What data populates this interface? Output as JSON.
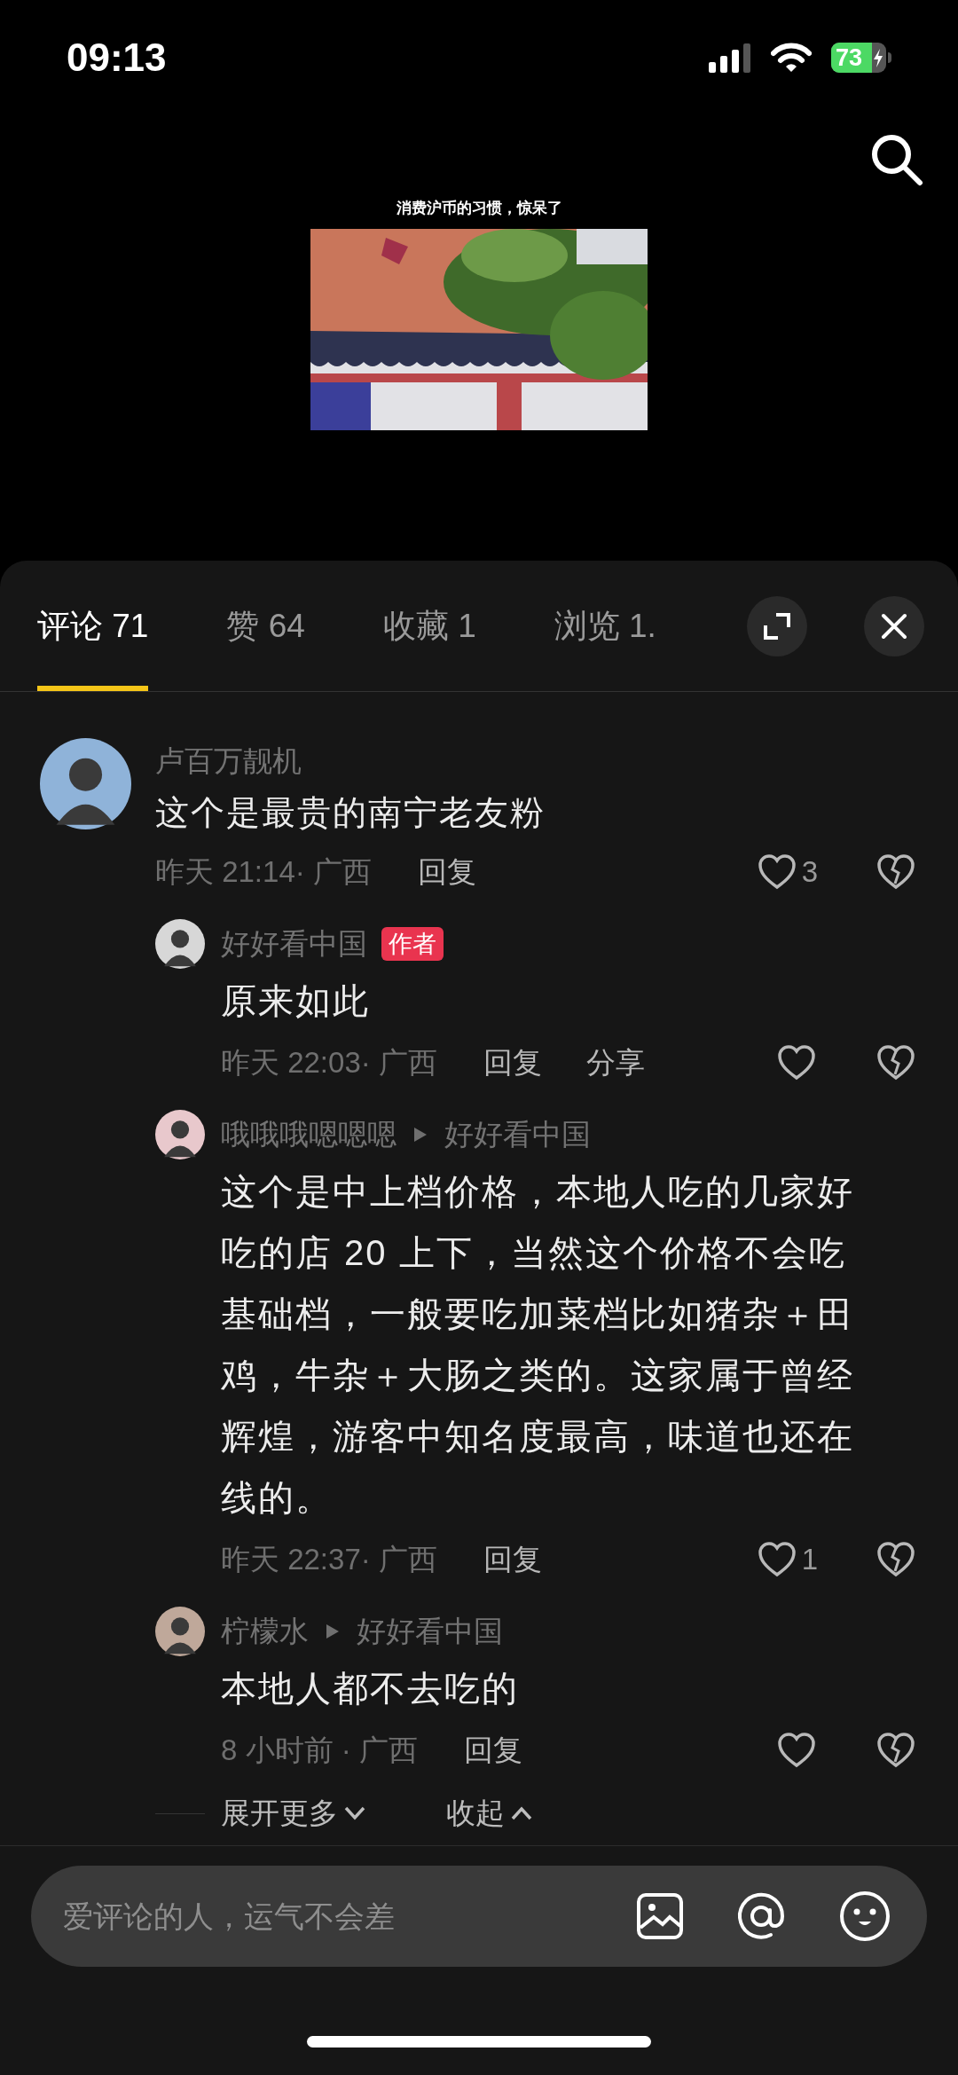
{
  "status_bar": {
    "time": "09:13",
    "battery": "73"
  },
  "video": {
    "caption": "消费沪币的习惯，惊呆了"
  },
  "tabs": [
    {
      "label": "评论 71",
      "selected": true
    },
    {
      "label": "赞 64",
      "selected": false
    },
    {
      "label": "收藏 1",
      "selected": false
    },
    {
      "label": "浏览 1.",
      "selected": false
    }
  ],
  "comments": [
    {
      "user": "卢百万靓机",
      "text": "这个是最贵的南宁老友粉",
      "meta": "昨天 21:14· 广西",
      "actions": [
        "回复"
      ],
      "likes": "3",
      "replies": [
        {
          "user": "好好看中国",
          "badge": "作者",
          "text": "原来如此",
          "meta": "昨天 22:03· 广西",
          "actions": [
            "回复",
            "分享"
          ]
        },
        {
          "user": "哦哦哦嗯嗯嗯",
          "reply_to": "好好看中国",
          "text": "这个是中上档价格，本地人吃的几家好吃的店 20 上下，当然这个价格不会吃基础档，一般要吃加菜档比如猪杂＋田鸡，牛杂＋大肠之类的。这家属于曾经辉煌，游客中知名度最高，味道也还在线的。",
          "meta": "昨天 22:37· 广西",
          "actions": [
            "回复"
          ],
          "likes": "1"
        },
        {
          "user": "柠檬水",
          "reply_to": "好好看中国",
          "text": "本地人都不去吃的",
          "meta": "8 小时前 · 广西",
          "actions": [
            "回复"
          ]
        }
      ]
    }
  ],
  "thread_controls": {
    "expand": "展开更多",
    "collapse": "收起"
  },
  "input": {
    "placeholder": "爱评论的人，运气不会差"
  }
}
